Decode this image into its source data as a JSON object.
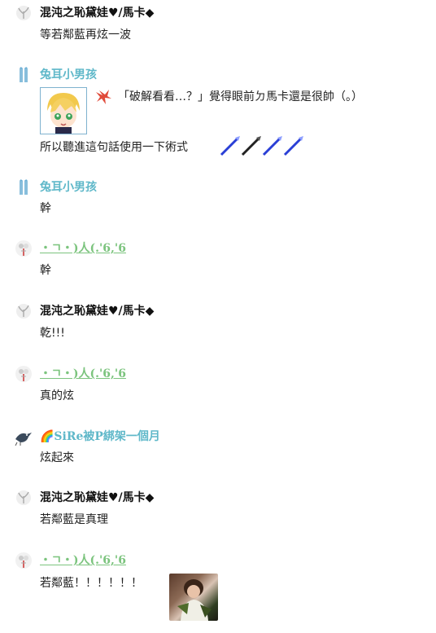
{
  "messages": [
    {
      "avatar": "plant-avatar-icon",
      "name": "混沌之恥黛娃♥/馬卡◆",
      "name_style": "black",
      "text": "等若鄰藍再炫一波"
    },
    {
      "avatar": "rabbit-avatar-icon",
      "name": "兔耳小男孩",
      "name_style": "teal",
      "sticker": "anime-boy-sticker",
      "quote": "「破解看看…？」覺得眼前ㄉ馬卡還是很帥（。）",
      "text": "所以聽進這句話使用一下術式"
    },
    {
      "avatar": "rabbit-avatar-icon",
      "name": "兔耳小男孩",
      "name_style": "teal",
      "text": "幹"
    },
    {
      "avatar": "flower-avatar-icon",
      "name": "・ㄱ・)人(.'6,'6",
      "name_style": "green",
      "text": "幹"
    },
    {
      "avatar": "plant-avatar-icon",
      "name": "混沌之恥黛娃♥/馬卡◆",
      "name_style": "black",
      "text": "乾!!!"
    },
    {
      "avatar": "flower-avatar-icon",
      "name": "・ㄱ・)人(.'6,'6",
      "name_style": "green",
      "text": "真的炫"
    },
    {
      "avatar": "bird-avatar-icon",
      "name": "🌈SiRe被P綁架一個月",
      "name_style": "teal",
      "text": "炫起來"
    },
    {
      "avatar": "plant-avatar-icon",
      "name": "混沌之恥黛娃♥/馬卡◆",
      "name_style": "black",
      "text": "若鄰藍是真理"
    },
    {
      "avatar": "flower-avatar-icon",
      "name": "・ㄱ・)人(.'6,'6",
      "name_style": "green",
      "text": "若鄰藍！！！！！！",
      "photo": "girl-photo"
    }
  ],
  "colors": {
    "name_black": "#111111",
    "name_teal": "#5fb8c9",
    "name_green": "#7cc47e",
    "wand_blue": "#2a3fd6",
    "wand_black": "#222222"
  }
}
